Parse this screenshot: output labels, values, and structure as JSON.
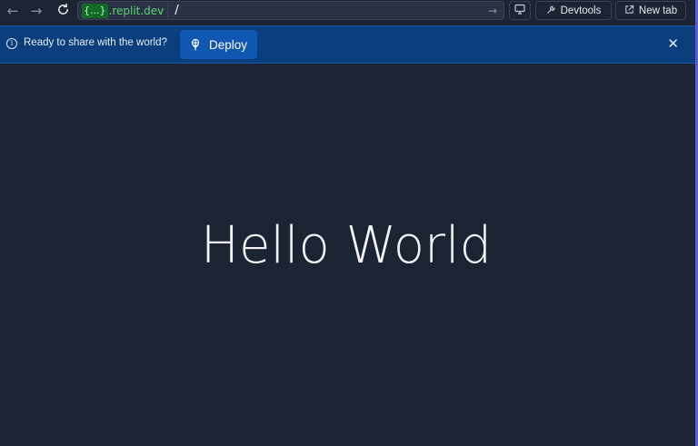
{
  "toolbar": {
    "back_icon": "arrow-left-icon",
    "forward_icon": "arrow-right-icon",
    "reload_icon": "reload-icon",
    "url": {
      "host_chip": "{...}",
      "host_suffix": ".replit.dev",
      "path": "/"
    },
    "devtools_label": "Devtools",
    "new_tab_label": "New tab"
  },
  "banner": {
    "message": "Ready to share with the world?",
    "deploy_label": "Deploy",
    "close_icon": "close-icon"
  },
  "page": {
    "heading": "Hello World"
  },
  "colors": {
    "background": "#1c2333",
    "banner": "#0a3e7d",
    "deploy_button": "#0f57b0",
    "host_text": "#5bd46d",
    "accent_border": "#5b5fcf"
  }
}
